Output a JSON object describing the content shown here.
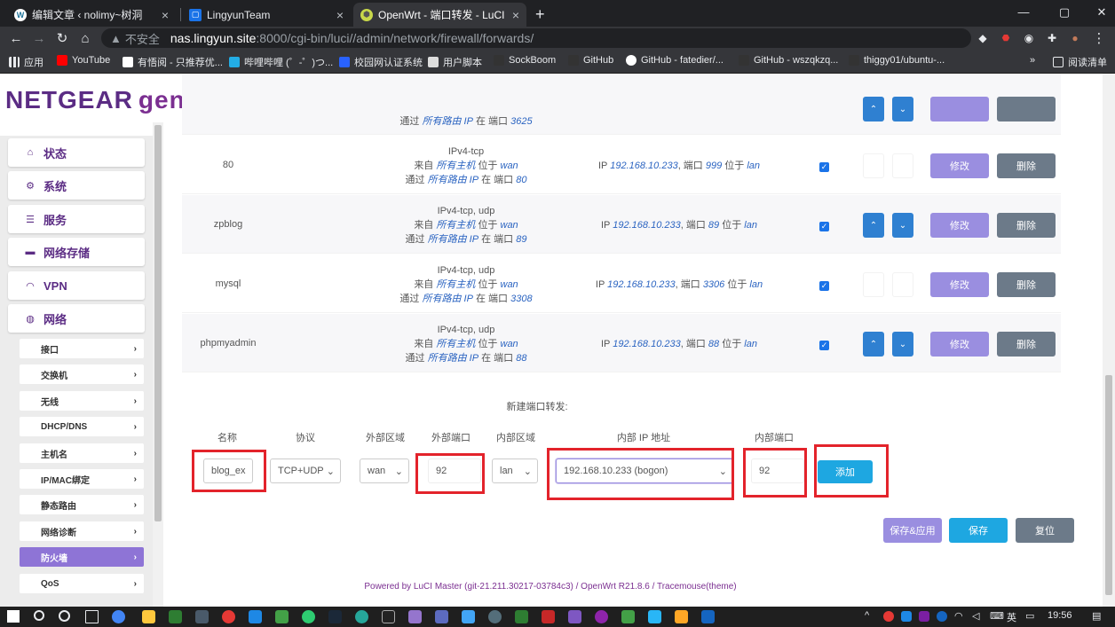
{
  "tabs": [
    {
      "title": "编辑文章 ‹ nolimy~树洞",
      "favicon": "wordpress-icon"
    },
    {
      "title": "LingyunTeam",
      "favicon": "docs-icon"
    },
    {
      "title": "OpenWrt - 端口转发 - LuCI",
      "favicon": "openwrt-icon"
    }
  ],
  "omnibox": {
    "security": "不安全",
    "host": "nas.lingyun.site",
    "path": ":8000/cgi-bin/luci//admin/network/firewall/forwards/"
  },
  "bookmarks": [
    "应用",
    "YouTube",
    "有悟阅 - 只推荐优...",
    "哔哩哔哩 (゜-゜)つ...",
    "校园网认证系统",
    "用户脚本",
    "SockBoom",
    "GitHub",
    "GitHub - fatedier/...",
    "GitHub - wszqkzq...",
    "thiggy01/ubuntu-..."
  ],
  "reading_list": "阅读清单",
  "logo": {
    "brand": "NETGEAR",
    "product": "genie"
  },
  "sidebar": {
    "menus": [
      {
        "label": "状态",
        "icon": "home-icon"
      },
      {
        "label": "系统",
        "icon": "gears-icon"
      },
      {
        "label": "服务",
        "icon": "list-icon"
      },
      {
        "label": "网络存储",
        "icon": "drive-icon"
      },
      {
        "label": "VPN",
        "icon": "gauge-icon"
      },
      {
        "label": "网络",
        "icon": "globe-icon"
      }
    ],
    "submenus": [
      "接口",
      "交换机",
      "无线",
      "DHCP/DNS",
      "主机名",
      "IP/MAC绑定",
      "静态路由",
      "网络诊断",
      "防火墙",
      "QoS"
    ],
    "active_sub": "防火墙"
  },
  "rules": [
    {
      "name": "",
      "proto": "",
      "from_pre": "",
      "from_host": "",
      "from_zone": "",
      "via_pre": "通过",
      "via_ip": "所有路由 IP",
      "via_port_pre": "在 端口",
      "via_port": "3625",
      "dest_ip": "",
      "dest_port": "",
      "dest_zone": "",
      "arrows": true
    },
    {
      "name": "80",
      "proto": "IPv4-tcp",
      "from_pre": "来自",
      "from_host": "所有主机",
      "from_zone_pre": "位于",
      "from_zone": "wan",
      "via_pre": "通过",
      "via_ip": "所有路由 IP",
      "via_port_pre": "在 端口",
      "via_port": "80",
      "dest_pre": "IP",
      "dest_ip": "192.168.10.233",
      "dest_port_pre": ", 端口",
      "dest_port": "999",
      "dest_zone_pre": "位于",
      "dest_zone": "lan",
      "arrows": false
    },
    {
      "name": "zpblog",
      "proto": "IPv4-tcp, udp",
      "from_pre": "来自",
      "from_host": "所有主机",
      "from_zone_pre": "位于",
      "from_zone": "wan",
      "via_pre": "通过",
      "via_ip": "所有路由 IP",
      "via_port_pre": "在 端口",
      "via_port": "89",
      "dest_pre": "IP",
      "dest_ip": "192.168.10.233",
      "dest_port_pre": ", 端口",
      "dest_port": "89",
      "dest_zone_pre": "位于",
      "dest_zone": "lan",
      "arrows": true
    },
    {
      "name": "mysql",
      "proto": "IPv4-tcp, udp",
      "from_pre": "来自",
      "from_host": "所有主机",
      "from_zone_pre": "位于",
      "from_zone": "wan",
      "via_pre": "通过",
      "via_ip": "所有路由 IP",
      "via_port_pre": "在 端口",
      "via_port": "3308",
      "dest_pre": "IP",
      "dest_ip": "192.168.10.233",
      "dest_port_pre": ", 端口",
      "dest_port": "3306",
      "dest_zone_pre": "位于",
      "dest_zone": "lan",
      "arrows": false
    },
    {
      "name": "phpmyadmin",
      "proto": "IPv4-tcp, udp",
      "from_pre": "来自",
      "from_host": "所有主机",
      "from_zone_pre": "位于",
      "from_zone": "wan",
      "via_pre": "通过",
      "via_ip": "所有路由 IP",
      "via_port_pre": "在 端口",
      "via_port": "88",
      "dest_pre": "IP",
      "dest_ip": "192.168.10.233",
      "dest_port_pre": ", 端口",
      "dest_port": "88",
      "dest_zone_pre": "位于",
      "dest_zone": "lan",
      "arrows": true
    }
  ],
  "row_buttons": {
    "edit": "修改",
    "delete": "删除"
  },
  "new_forward": {
    "title": "新建端口转发:",
    "headers": {
      "name": "名称",
      "proto": "协议",
      "ext_zone": "外部区域",
      "ext_port": "外部端口",
      "int_zone": "内部区域",
      "int_ip": "内部 IP 地址",
      "int_port": "内部端口"
    },
    "values": {
      "name": "blog_ex",
      "proto": "TCP+UDP",
      "ext_zone": "wan",
      "ext_port": "92",
      "int_zone": "lan",
      "int_ip": "192.168.10.233 (bogon)",
      "int_port": "92"
    },
    "add": "添加"
  },
  "footer_buttons": {
    "save_apply": "保存&应用",
    "save": "保存",
    "reset": "复位"
  },
  "footer": "Powered by LuCI Master (git-21.211.30217-03784c3) / OpenWrt R21.8.6 / Tracemouse(theme)",
  "taskbar": {
    "lang": "英",
    "time": "19:56"
  },
  "colors": {
    "accent": "#5b2c84",
    "edit": "#9a8ee0",
    "delete": "#6c7a89",
    "add": "#1ea7e1",
    "highlight": "#e3232b"
  }
}
